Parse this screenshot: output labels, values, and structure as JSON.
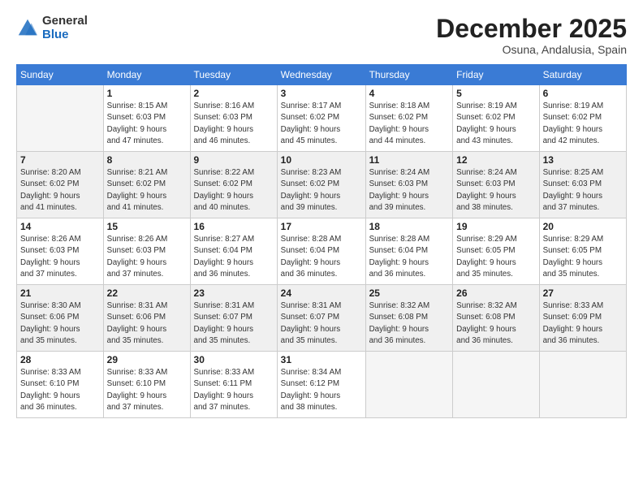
{
  "header": {
    "logo_general": "General",
    "logo_blue": "Blue",
    "month": "December 2025",
    "location": "Osuna, Andalusia, Spain"
  },
  "days_of_week": [
    "Sunday",
    "Monday",
    "Tuesday",
    "Wednesday",
    "Thursday",
    "Friday",
    "Saturday"
  ],
  "weeks": [
    [
      {
        "day": "",
        "info": ""
      },
      {
        "day": "1",
        "info": "Sunrise: 8:15 AM\nSunset: 6:03 PM\nDaylight: 9 hours\nand 47 minutes."
      },
      {
        "day": "2",
        "info": "Sunrise: 8:16 AM\nSunset: 6:03 PM\nDaylight: 9 hours\nand 46 minutes."
      },
      {
        "day": "3",
        "info": "Sunrise: 8:17 AM\nSunset: 6:02 PM\nDaylight: 9 hours\nand 45 minutes."
      },
      {
        "day": "4",
        "info": "Sunrise: 8:18 AM\nSunset: 6:02 PM\nDaylight: 9 hours\nand 44 minutes."
      },
      {
        "day": "5",
        "info": "Sunrise: 8:19 AM\nSunset: 6:02 PM\nDaylight: 9 hours\nand 43 minutes."
      },
      {
        "day": "6",
        "info": "Sunrise: 8:19 AM\nSunset: 6:02 PM\nDaylight: 9 hours\nand 42 minutes."
      }
    ],
    [
      {
        "day": "7",
        "info": ""
      },
      {
        "day": "8",
        "info": "Sunrise: 8:21 AM\nSunset: 6:02 PM\nDaylight: 9 hours\nand 41 minutes."
      },
      {
        "day": "9",
        "info": "Sunrise: 8:22 AM\nSunset: 6:02 PM\nDaylight: 9 hours\nand 40 minutes."
      },
      {
        "day": "10",
        "info": "Sunrise: 8:23 AM\nSunset: 6:02 PM\nDaylight: 9 hours\nand 39 minutes."
      },
      {
        "day": "11",
        "info": "Sunrise: 8:24 AM\nSunset: 6:03 PM\nDaylight: 9 hours\nand 39 minutes."
      },
      {
        "day": "12",
        "info": "Sunrise: 8:24 AM\nSunset: 6:03 PM\nDaylight: 9 hours\nand 38 minutes."
      },
      {
        "day": "13",
        "info": "Sunrise: 8:25 AM\nSunset: 6:03 PM\nDaylight: 9 hours\nand 37 minutes."
      }
    ],
    [
      {
        "day": "14",
        "info": ""
      },
      {
        "day": "15",
        "info": "Sunrise: 8:26 AM\nSunset: 6:03 PM\nDaylight: 9 hours\nand 37 minutes."
      },
      {
        "day": "16",
        "info": "Sunrise: 8:27 AM\nSunset: 6:04 PM\nDaylight: 9 hours\nand 36 minutes."
      },
      {
        "day": "17",
        "info": "Sunrise: 8:28 AM\nSunset: 6:04 PM\nDaylight: 9 hours\nand 36 minutes."
      },
      {
        "day": "18",
        "info": "Sunrise: 8:28 AM\nSunset: 6:04 PM\nDaylight: 9 hours\nand 36 minutes."
      },
      {
        "day": "19",
        "info": "Sunrise: 8:29 AM\nSunset: 6:05 PM\nDaylight: 9 hours\nand 35 minutes."
      },
      {
        "day": "20",
        "info": "Sunrise: 8:29 AM\nSunset: 6:05 PM\nDaylight: 9 hours\nand 35 minutes."
      }
    ],
    [
      {
        "day": "21",
        "info": ""
      },
      {
        "day": "22",
        "info": "Sunrise: 8:31 AM\nSunset: 6:06 PM\nDaylight: 9 hours\nand 35 minutes."
      },
      {
        "day": "23",
        "info": "Sunrise: 8:31 AM\nSunset: 6:07 PM\nDaylight: 9 hours\nand 35 minutes."
      },
      {
        "day": "24",
        "info": "Sunrise: 8:31 AM\nSunset: 6:07 PM\nDaylight: 9 hours\nand 35 minutes."
      },
      {
        "day": "25",
        "info": "Sunrise: 8:32 AM\nSunset: 6:08 PM\nDaylight: 9 hours\nand 36 minutes."
      },
      {
        "day": "26",
        "info": "Sunrise: 8:32 AM\nSunset: 6:08 PM\nDaylight: 9 hours\nand 36 minutes."
      },
      {
        "day": "27",
        "info": "Sunrise: 8:33 AM\nSunset: 6:09 PM\nDaylight: 9 hours\nand 36 minutes."
      }
    ],
    [
      {
        "day": "28",
        "info": "Sunrise: 8:33 AM\nSunset: 6:10 PM\nDaylight: 9 hours\nand 36 minutes."
      },
      {
        "day": "29",
        "info": "Sunrise: 8:33 AM\nSunset: 6:10 PM\nDaylight: 9 hours\nand 37 minutes."
      },
      {
        "day": "30",
        "info": "Sunrise: 8:33 AM\nSunset: 6:11 PM\nDaylight: 9 hours\nand 37 minutes."
      },
      {
        "day": "31",
        "info": "Sunrise: 8:34 AM\nSunset: 6:12 PM\nDaylight: 9 hours\nand 38 minutes."
      },
      {
        "day": "",
        "info": ""
      },
      {
        "day": "",
        "info": ""
      },
      {
        "day": "",
        "info": ""
      }
    ]
  ],
  "week7_sunday_info": "Sunrise: 8:20 AM\nSunset: 6:02 PM\nDaylight: 9 hours\nand 41 minutes.",
  "week14_sunday_info": "Sunrise: 8:26 AM\nSunset: 6:03 PM\nDaylight: 9 hours\nand 37 minutes.",
  "week21_sunday_info": "Sunrise: 8:30 AM\nSunset: 6:06 PM\nDaylight: 9 hours\nand 35 minutes."
}
